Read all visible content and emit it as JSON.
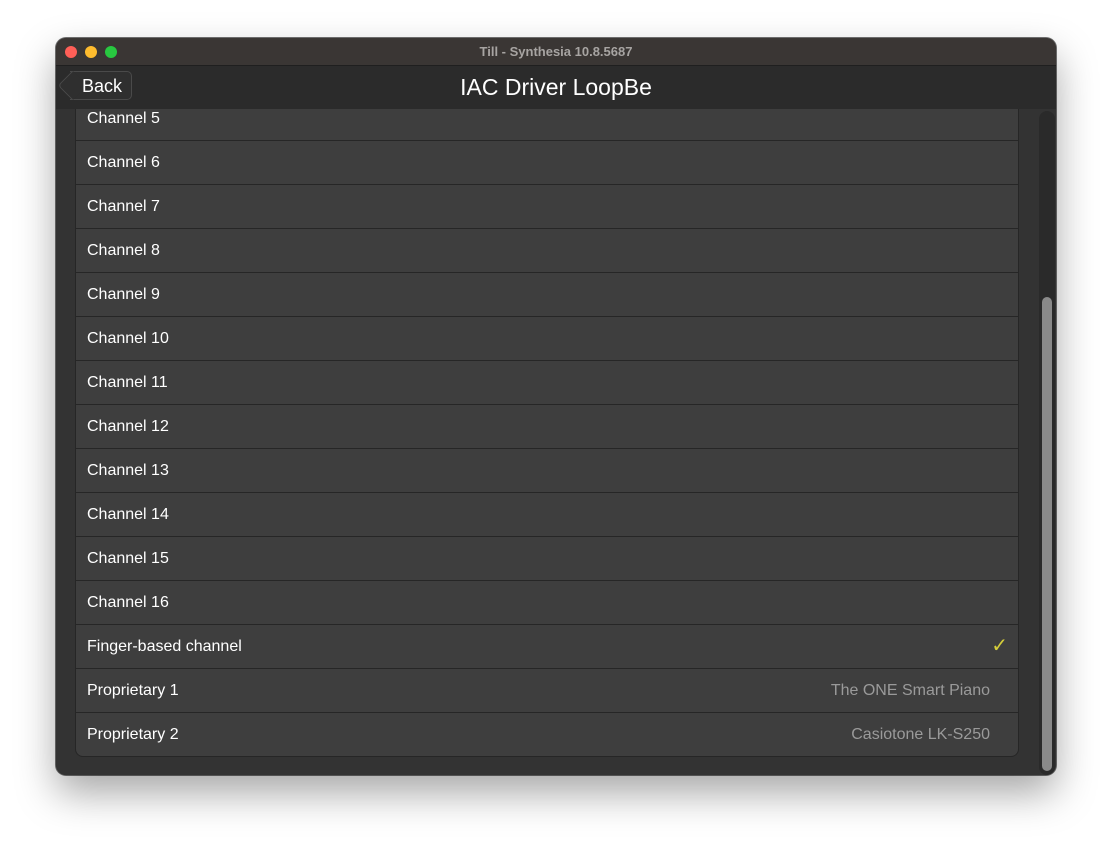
{
  "window": {
    "title": "Till - Synthesia 10.8.5687",
    "traffic_lights": {
      "close_color": "#ff5f57",
      "minimize_color": "#febc2e",
      "zoom_color": "#28c840"
    }
  },
  "header": {
    "back_label": "Back",
    "title": "IAC Driver LoopBe"
  },
  "list": {
    "rows": [
      {
        "label": "Channel 5",
        "detail": ""
      },
      {
        "label": "Channel 6",
        "detail": ""
      },
      {
        "label": "Channel 7",
        "detail": ""
      },
      {
        "label": "Channel 8",
        "detail": ""
      },
      {
        "label": "Channel 9",
        "detail": ""
      },
      {
        "label": "Channel 10",
        "detail": ""
      },
      {
        "label": "Channel 11",
        "detail": ""
      },
      {
        "label": "Channel 12",
        "detail": ""
      },
      {
        "label": "Channel 13",
        "detail": ""
      },
      {
        "label": "Channel 14",
        "detail": ""
      },
      {
        "label": "Channel 15",
        "detail": ""
      },
      {
        "label": "Channel 16",
        "detail": ""
      },
      {
        "label": "Finger-based channel",
        "detail": "",
        "check": "✓"
      },
      {
        "label": "Proprietary 1",
        "detail": "The ONE Smart Piano"
      },
      {
        "label": "Proprietary 2",
        "detail": "Casiotone LK-S250"
      }
    ],
    "selected_index": 12,
    "check_color": "#d4cd3a"
  },
  "scroll": {
    "position_fraction": 1.0
  }
}
